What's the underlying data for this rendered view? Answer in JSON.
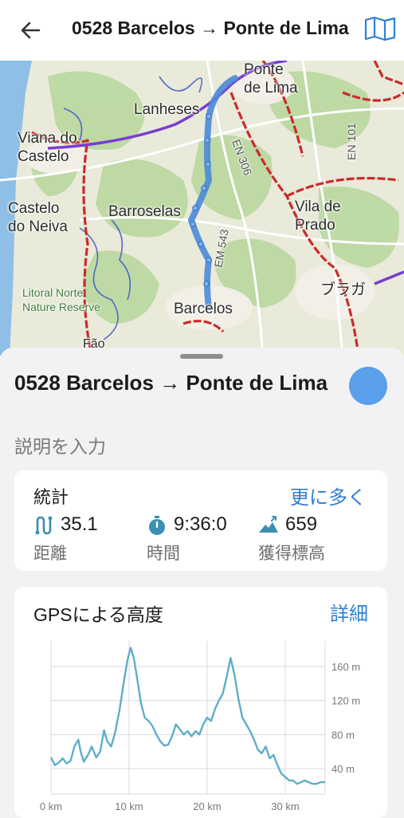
{
  "header": {
    "title": "0528 Barcelos → Ponte de Lima",
    "back_icon": "arrow-left-icon",
    "map_icon": "folded-map-icon"
  },
  "map": {
    "labels": {
      "ponte_de_lima": "Ponte\nde Lima",
      "lanheses": "Lanheses",
      "viana": "Viana do\nCastelo",
      "castelo_neiva": "Castelo\ndo Neiva",
      "barroselas": "Barroselas",
      "vila_de_prado": "Vila de\nPrado",
      "barcelos": "Barcelos",
      "braga": "ブラガ",
      "litoral": "Litoral Norte\nNature Reserve",
      "fao": "Fão",
      "en306": "EN 306",
      "en101": "EN 101",
      "em543": "EM 543"
    },
    "colors": {
      "route": "#4a8ad8",
      "trail": "#d22f2f",
      "path": "#7a3dd0",
      "water": "#7bb2e0",
      "forest": "#b9d7a0"
    }
  },
  "sheet": {
    "route_title": "0528 Barcelos → Ponte de Lima",
    "route_color": "#5aa0eb",
    "description_placeholder": "説明を入力"
  },
  "stats": {
    "heading": "統計",
    "more_label": "更に多く",
    "distance": {
      "icon": "route-distance-icon",
      "value": "35.1",
      "label": "距離"
    },
    "time": {
      "icon": "stopwatch-icon",
      "value": "9:36:0",
      "label": "時間"
    },
    "elevation_gain": {
      "icon": "elevation-gain-icon",
      "value": "659",
      "label": "獲得標高"
    }
  },
  "elevation": {
    "heading": "GPSによる高度",
    "details_label": "詳細"
  },
  "chart_data": {
    "type": "line",
    "title": "GPSによる高度",
    "x_unit": "km",
    "y_unit": "m",
    "x_ticks": [
      "0 km",
      "10 km",
      "20 km",
      "30 km"
    ],
    "y_ticks": [
      "40 m",
      "80 m",
      "120 m",
      "160 m"
    ],
    "xlim": [
      0,
      35.1
    ],
    "ylim": [
      10,
      190
    ],
    "line_color": "#5eaec8",
    "series": [
      {
        "x": [
          0,
          0.5,
          1.0,
          1.5,
          2.0,
          2.5,
          3.0,
          3.5,
          3.8,
          4.2,
          4.8,
          5.2,
          5.8,
          6.3,
          6.8,
          7.2,
          7.7,
          8.2,
          8.8,
          9.3,
          9.8,
          10.2,
          10.6,
          11.0,
          11.5,
          12.0,
          12.5,
          13.0,
          13.5,
          14.0,
          14.5,
          15.0,
          15.5,
          16.0,
          16.5,
          17.0,
          17.5,
          18.0,
          18.5,
          19.0,
          19.5,
          20.0,
          20.5,
          21.0,
          21.5,
          22.0,
          22.5,
          23.0,
          23.5,
          24.0,
          24.5,
          25.0,
          25.5,
          26.0,
          26.5,
          27.0,
          27.5,
          28.0,
          28.5,
          29.0,
          29.5,
          30.0,
          30.5,
          31.0,
          31.5,
          32.0,
          32.5,
          33.0,
          33.5,
          34.0,
          34.5,
          35.1
        ],
        "y": [
          53,
          44,
          47,
          52,
          46,
          49,
          66,
          74,
          60,
          48,
          57,
          66,
          53,
          60,
          85,
          72,
          66,
          82,
          110,
          140,
          168,
          182,
          170,
          148,
          118,
          100,
          96,
          90,
          80,
          72,
          67,
          68,
          78,
          92,
          86,
          80,
          84,
          78,
          84,
          80,
          92,
          100,
          96,
          110,
          120,
          128,
          148,
          170,
          150,
          122,
          100,
          92,
          84,
          74,
          62,
          58,
          66,
          52,
          56,
          44,
          34,
          30,
          26,
          26,
          22,
          24,
          26,
          24,
          22,
          22,
          24,
          24
        ]
      }
    ]
  }
}
